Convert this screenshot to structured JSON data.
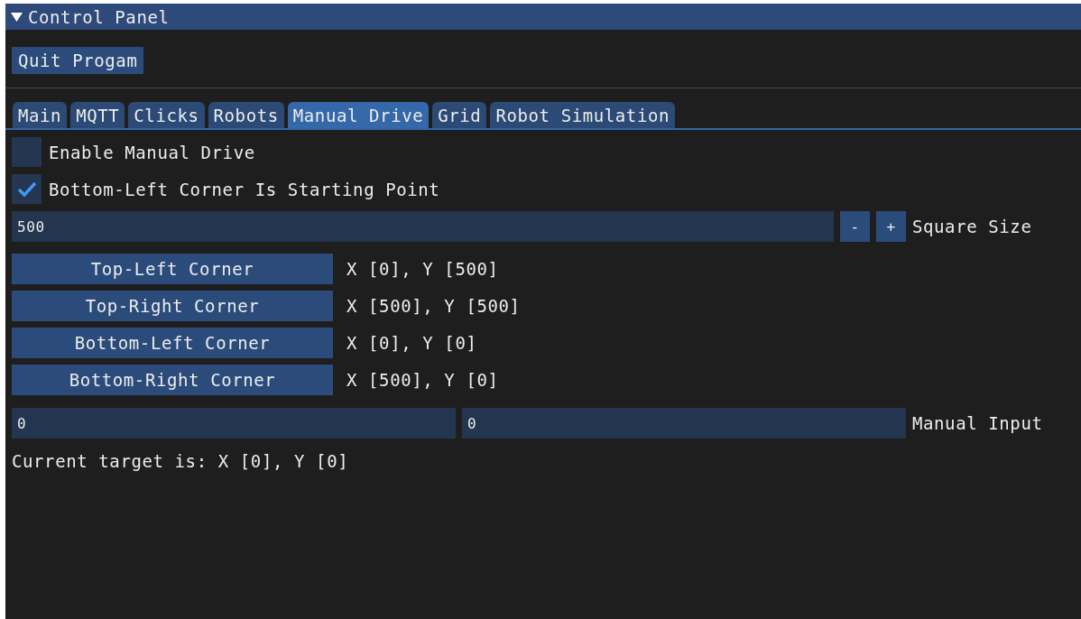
{
  "window": {
    "title": "Control Panel",
    "expanded": true
  },
  "quit_button": "Quit Progam",
  "tabs": [
    {
      "label": "Main",
      "selected": false
    },
    {
      "label": "MQTT",
      "selected": false
    },
    {
      "label": "Clicks",
      "selected": false
    },
    {
      "label": "Robots",
      "selected": false
    },
    {
      "label": "Manual Drive",
      "selected": true
    },
    {
      "label": "Grid",
      "selected": false
    },
    {
      "label": "Robot Simulation",
      "selected": false
    }
  ],
  "checkboxes": [
    {
      "label": "Enable Manual Drive",
      "checked": false
    },
    {
      "label": "Bottom-Left Corner Is Starting Point",
      "checked": true
    }
  ],
  "square_size": {
    "value": "500",
    "minus": "-",
    "plus": "+",
    "label": "Square Size"
  },
  "corners": [
    {
      "button": "Top-Left Corner",
      "coords": "X [0], Y [500]"
    },
    {
      "button": "Top-Right Corner",
      "coords": "X [500], Y [500]"
    },
    {
      "button": "Bottom-Left Corner",
      "coords": "X [0], Y [0]"
    },
    {
      "button": "Bottom-Right Corner",
      "coords": "X [500], Y [0]"
    }
  ],
  "manual_input": {
    "values": [
      "0",
      "0"
    ],
    "label": "Manual Input"
  },
  "status": "Current target is: X [0], Y [0]"
}
